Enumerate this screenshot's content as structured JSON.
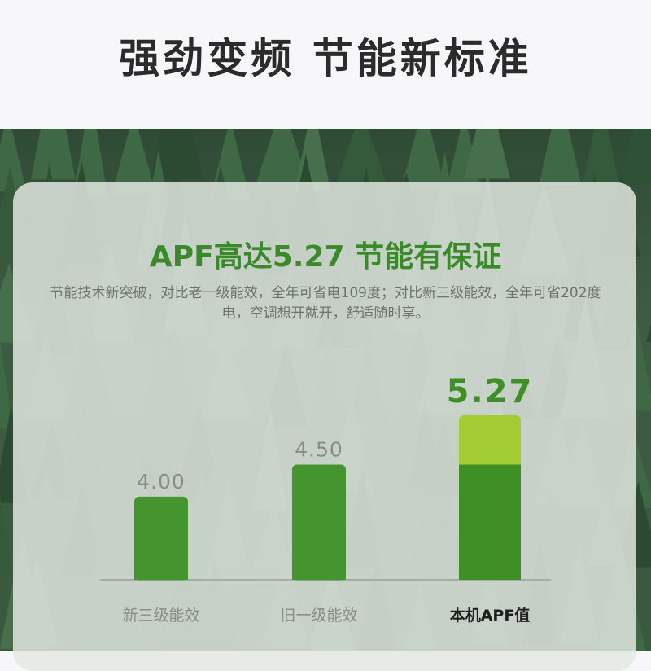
{
  "header": {
    "title": "强劲变频 节能新标准"
  },
  "panel": {
    "title": "APF高达5.27 节能有保证",
    "description": "节能技术新突破，对比老一级能效，全年可省电109度；对比新三级能效，全年可省202度电，空调想开就开，舒适随时享。"
  },
  "chart_data": {
    "type": "bar",
    "categories": [
      "新三级能效",
      "旧一级能效",
      "本机APF值"
    ],
    "values": [
      4.0,
      4.5,
      5.27
    ],
    "value_labels": [
      "4.00",
      "4.50",
      "5.27"
    ],
    "highlight_index": 2,
    "highlight_base_value": 4.5,
    "ylim": [
      2.7,
      5.27
    ],
    "grid": false,
    "colors": {
      "bar": "#44952d",
      "highlight_base": "#3f8f27",
      "highlight_top": "#a3cb33",
      "label": "#8a8c8a",
      "highlight_label": "#3f8f27",
      "category": "#8a8c8a",
      "highlight_category": "#1e1e1e",
      "baseline": "#9aa39a"
    }
  }
}
